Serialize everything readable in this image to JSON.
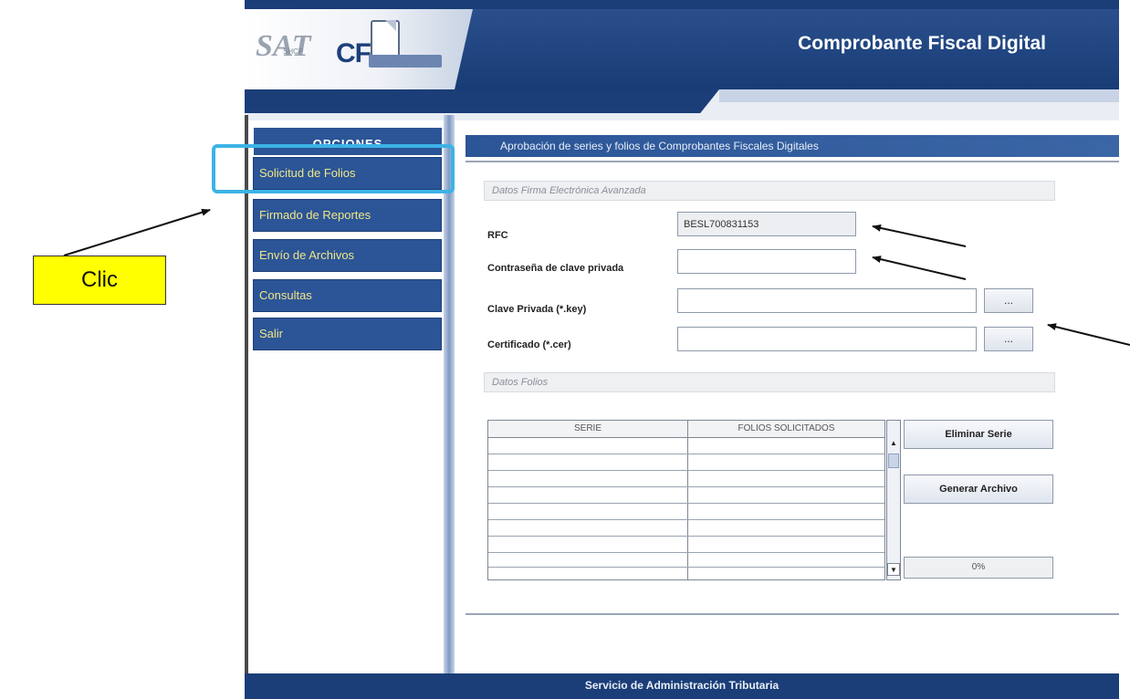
{
  "header": {
    "app_title": "Comprobante Fiscal Digital",
    "logo_text": "CFD",
    "logo_sat_text": "SAT",
    "logo_sat_caption": "SHCP"
  },
  "sidebar": {
    "title": "OPCIONES",
    "items": [
      {
        "label": "Solicitud de Folios"
      },
      {
        "label": "Firmado de Reportes"
      },
      {
        "label": "Envío de Archivos"
      },
      {
        "label": "Consultas"
      },
      {
        "label": "Salir"
      }
    ]
  },
  "callout": {
    "label": "Clic"
  },
  "content": {
    "title": "Aprobación de series y folios de Comprobantes Fiscales Digitales",
    "section_firma": "Datos Firma Electrónica Avanzada",
    "rfc": {
      "label": "RFC",
      "value": "BESL700831153"
    },
    "password": {
      "label": "Contraseña de clave privada",
      "value": ""
    },
    "private_key": {
      "label": "Clave Privada (*.key)",
      "value": "",
      "browse": "..."
    },
    "certificate": {
      "label": "Certificado (*.cer)",
      "value": "",
      "browse": "..."
    },
    "section_folios": "Datos Folios",
    "table": {
      "columns": [
        "SERIE",
        "FOLIOS SOLICITADOS"
      ],
      "rows": [
        [
          "",
          ""
        ],
        [
          "",
          ""
        ],
        [
          "",
          ""
        ],
        [
          "",
          ""
        ],
        [
          "",
          ""
        ],
        [
          "",
          ""
        ],
        [
          "",
          ""
        ],
        [
          "",
          ""
        ],
        [
          "",
          ""
        ]
      ]
    },
    "buttons": {
      "delete_series": "Eliminar Serie",
      "generate_file": "Generar Archivo"
    },
    "progress": {
      "label": "0%",
      "value": 0
    }
  },
  "footer": {
    "text": "Servicio de Administración Tributaria"
  },
  "colors": {
    "primary": "#1b3e78",
    "sidebar_item": "#2b5596",
    "sidebar_text": "#f1e58a",
    "highlight": "#3cb3e6",
    "callout": "#ffff00"
  }
}
